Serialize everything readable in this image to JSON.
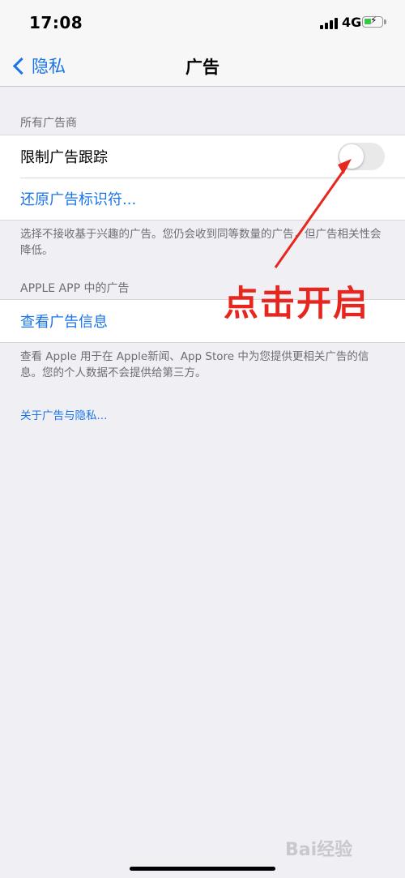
{
  "status_bar": {
    "time": "17:08",
    "network": "4G"
  },
  "nav": {
    "back_label": "隐私",
    "title": "广告"
  },
  "sections": {
    "all_advertisers_header": "所有广告商",
    "limit_tracking_label": "限制广告跟踪",
    "limit_tracking_enabled": false,
    "reset_identifier_label": "还原广告标识符...",
    "footer_1": "选择不接收基于兴趣的广告。您仍会收到同等数量的广告，但广告相关性会降低。",
    "apple_app_header": "APPLE APP 中的广告",
    "view_ad_info_label": "查看广告信息",
    "footer_2": "查看 Apple 用于在 Apple新闻、App Store 中为您提供更相关广告的信息。您的个人数据不会提供给第三方。",
    "about_link": "关于广告与隐私..."
  },
  "annotation": {
    "text": "点击开启",
    "color": "#e6261f"
  },
  "colors": {
    "accent": "#1a74e8",
    "background": "#efeff4",
    "toggle_off": "#e9e9ea"
  },
  "icons": {
    "back": "chevron-left-icon",
    "signal": "cellular-signal-icon",
    "battery": "battery-charging-icon"
  }
}
